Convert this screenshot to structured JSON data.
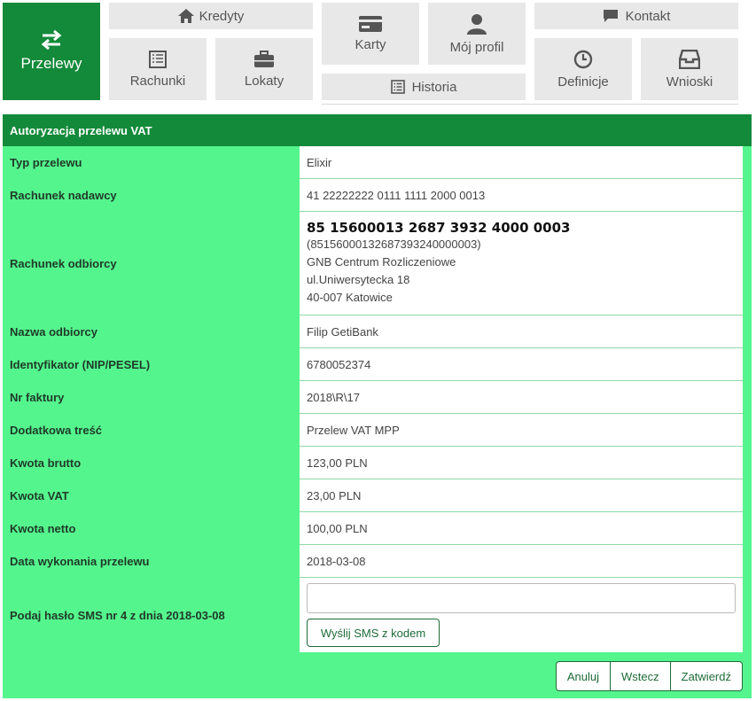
{
  "nav": {
    "przelewy": "Przelewy",
    "kredyty": "Kredyty",
    "rachunki": "Rachunki",
    "lokaty": "Lokaty",
    "karty": "Karty",
    "moj_profil": "Mój profil",
    "historia": "Historia",
    "kontakt": "Kontakt",
    "definicje": "Definicje",
    "wnioski": "Wnioski"
  },
  "panel": {
    "title": "Autoryzacja przelewu VAT",
    "rows": [
      {
        "label": "Typ przelewu",
        "value": "Elixir"
      },
      {
        "label": "Rachunek nadawcy",
        "value": "41 22222222 0111 1111 2000 0013"
      },
      {
        "label": "Rachunek odbiorcy",
        "value": "85 15600013 2687 3932 4000 0003"
      },
      {
        "label": "Nazwa odbiorcy",
        "value": "Filip GetiBank"
      },
      {
        "label": "Identyfikator (NIP/PESEL)",
        "value": "6780052374"
      },
      {
        "label": "Nr faktury",
        "value": "2018\\R\\17"
      },
      {
        "label": "Dodatkowa treść",
        "value": "Przelew VAT MPP"
      },
      {
        "label": "Kwota brutto",
        "value": "123,00 PLN"
      },
      {
        "label": "Kwota VAT",
        "value": "23,00 PLN"
      },
      {
        "label": "Kwota netto",
        "value": "100,00 PLN"
      },
      {
        "label": "Data wykonania przelewu",
        "value": "2018-03-08"
      },
      {
        "label": "Podaj hasło SMS nr 4 z dnia 2018-03-08",
        "value": ""
      }
    ],
    "recipient_details": {
      "raw": "(85156000132687393240000003)",
      "bank": "GNB Centrum Rozliczeniowe",
      "street": "ul.Uniwersytecka 18",
      "city": "40-007 Katowice"
    },
    "sms_input_value": "",
    "sms_button": "Wyślij SMS z kodem"
  },
  "actions": {
    "cancel": "Anuluj",
    "back": "Wstecz",
    "confirm": "Zatwierdź"
  },
  "colors": {
    "brand_green": "#138a3a",
    "panel_green": "#55f58e",
    "tile_gray": "#e8e8e8"
  },
  "icons": [
    "transfer-arrows-icon",
    "home-icon",
    "ledger-icon",
    "briefcase-icon",
    "card-icon",
    "user-icon",
    "list-icon",
    "chat-icon",
    "clock-icon",
    "inbox-icon"
  ]
}
